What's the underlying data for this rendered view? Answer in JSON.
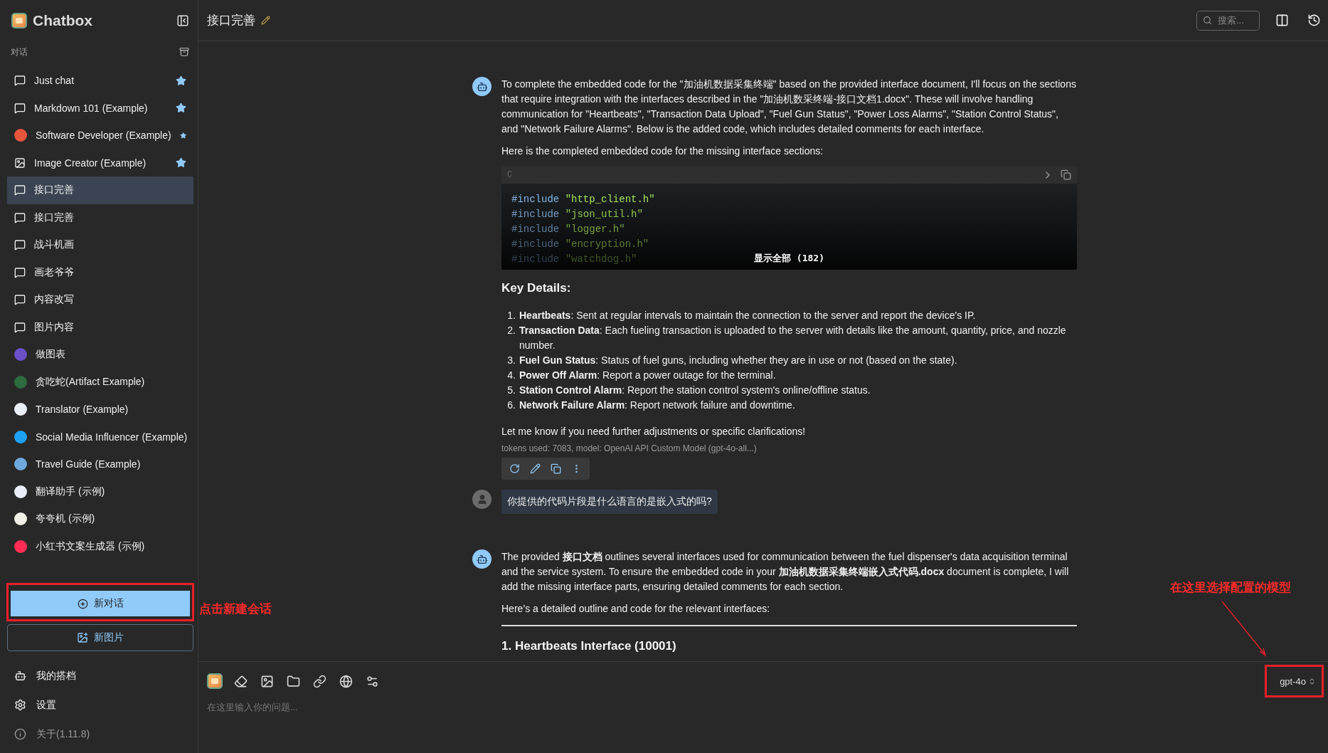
{
  "app": {
    "name": "Chatbox"
  },
  "sidebar": {
    "section_label": "对话",
    "items": [
      {
        "kind": "chat",
        "label": "Just chat",
        "starred": true,
        "selected": false
      },
      {
        "kind": "chat",
        "label": "Markdown 101 (Example)",
        "starred": true,
        "selected": false
      },
      {
        "kind": "avatar",
        "color": "#e8553d",
        "label": "Software Developer (Example)",
        "starred": true,
        "selected": false
      },
      {
        "kind": "image",
        "label": "Image Creator (Example)",
        "starred": true,
        "selected": false
      },
      {
        "kind": "chat",
        "label": "接口完善",
        "starred": false,
        "selected": true
      },
      {
        "kind": "chat",
        "label": "接口完善",
        "starred": false,
        "selected": false
      },
      {
        "kind": "chat",
        "label": "战斗机画",
        "starred": false,
        "selected": false
      },
      {
        "kind": "chat",
        "label": "画老爷爷",
        "starred": false,
        "selected": false
      },
      {
        "kind": "chat",
        "label": "内容改写",
        "starred": false,
        "selected": false
      },
      {
        "kind": "chat",
        "label": "图片内容",
        "starred": false,
        "selected": false
      },
      {
        "kind": "avatar",
        "color": "#6a4fc9",
        "label": "做图表",
        "starred": false,
        "selected": false
      },
      {
        "kind": "avatar",
        "color": "#2e6b3e",
        "label": "贪吃蛇(Artifact Example)",
        "starred": false,
        "selected": false
      },
      {
        "kind": "avatar",
        "color": "#e9eef7",
        "label": "Translator (Example)",
        "starred": false,
        "selected": false
      },
      {
        "kind": "avatar",
        "color": "#1da1f2",
        "label": "Social Media Influencer (Example)",
        "starred": false,
        "selected": false
      },
      {
        "kind": "avatar",
        "color": "#6fa8dc",
        "label": "Travel Guide (Example)",
        "starred": false,
        "selected": false
      },
      {
        "kind": "avatar",
        "color": "#e9eef7",
        "label": "翻译助手 (示例)",
        "starred": false,
        "selected": false
      },
      {
        "kind": "avatar",
        "color": "#f2efe6",
        "label": "夸夸机 (示例)",
        "starred": false,
        "selected": false
      },
      {
        "kind": "avatar",
        "color": "#fe2c55",
        "label": "小红书文案生成器 (示例)",
        "starred": false,
        "selected": false
      }
    ],
    "new_chat_button": {
      "label": "新对话",
      "highlighted": true
    },
    "new_image_button": {
      "label": "新图片"
    },
    "footer": [
      {
        "kind": "bot",
        "label": "我的搭档"
      },
      {
        "kind": "settings",
        "label": "设置"
      },
      {
        "kind": "info",
        "label": "关于(1.11.8)"
      }
    ]
  },
  "header": {
    "title": "接口完善",
    "search": {
      "placeholder": "搜索..."
    }
  },
  "messages": [
    {
      "kind": "assistant",
      "blocks": [
        {
          "kind": "paragraph",
          "text": "To complete the embedded code for the \"加油机数据采集终端\" based on the provided interface document, I'll focus on the sections that require integration with the interfaces described in the \"加油机数采终端-接口文档1.docx\". These will involve handling communication for \"Heartbeats\", \"Transaction Data Upload\", \"Fuel Gun Status\", \"Power Loss Alarms\", \"Station Control Status\", and \"Network Failure Alarms\". Below is the added code, which includes detailed comments for each interface."
        },
        {
          "kind": "paragraph",
          "text": "Here is the completed embedded code for the missing interface sections:"
        },
        {
          "kind": "code",
          "language": "C",
          "expand_label": "显示全部 (182)",
          "lines": [
            {
              "directive": "#include",
              "file": "\"http_client.h\""
            },
            {
              "directive": "#include",
              "file": "\"json_util.h\""
            },
            {
              "directive": "#include",
              "file": "\"logger.h\""
            },
            {
              "directive": "#include",
              "file": "\"encryption.h\""
            },
            {
              "directive": "#include",
              "file": "\"watchdog.h\""
            }
          ]
        },
        {
          "kind": "heading",
          "text": "Key Details:"
        },
        {
          "kind": "list",
          "items": [
            {
              "number": "1.",
              "text": "**Heartbeats**: Sent at regular intervals to maintain the connection to the server and report the device's IP."
            },
            {
              "number": "2.",
              "text": "**Transaction Data**: Each fueling transaction is uploaded to the server with details like the amount, quantity, price, and nozzle number."
            },
            {
              "number": "3.",
              "text": "**Fuel Gun Status**: Status of fuel guns, including whether they are in use or not (based on the state)."
            },
            {
              "number": "4.",
              "text": "**Power Off Alarm**: Report a power outage for the terminal."
            },
            {
              "number": "5.",
              "text": "**Station Control Alarm**: Report the station control system's online/offline status."
            },
            {
              "number": "6.",
              "text": "**Network Failure Alarm**: Report network failure and downtime."
            }
          ]
        },
        {
          "kind": "paragraph",
          "text": "Let me know if you need further adjustments or specific clarifications!"
        },
        {
          "kind": "meta",
          "text": "tokens used: 7083, model: OpenAI API Custom Model (gpt-4o-all...)"
        },
        {
          "kind": "actions"
        }
      ]
    },
    {
      "kind": "user",
      "blocks": [
        {
          "kind": "paragraph",
          "text": "你提供的代码片段是什么语言的是嵌入式的吗?"
        }
      ]
    },
    {
      "kind": "assistant",
      "blocks": [
        {
          "kind": "paragraph",
          "text": "The provided **接口文档** outlines several interfaces used for communication between the fuel dispenser's data acquisition terminal and the service system. To ensure the embedded code in your **加油机数据采集终端嵌入式代码.docx** document is complete, I will add the missing interface parts, ensuring detailed comments for each section."
        },
        {
          "kind": "paragraph",
          "text": "Here’s a detailed outline and code for the relevant interfaces:"
        },
        {
          "kind": "rule"
        },
        {
          "kind": "heading",
          "text": "1. Heartbeats Interface (10001)"
        }
      ]
    }
  ],
  "composer": {
    "placeholder": "在这里输入你的问题...",
    "model": {
      "label": "gpt-4o",
      "highlighted": true
    }
  },
  "annotations": [
    {
      "kind": "new_chat",
      "text": "点击新建会话"
    },
    {
      "kind": "model",
      "text": "在这里选择配置的模型"
    }
  ]
}
